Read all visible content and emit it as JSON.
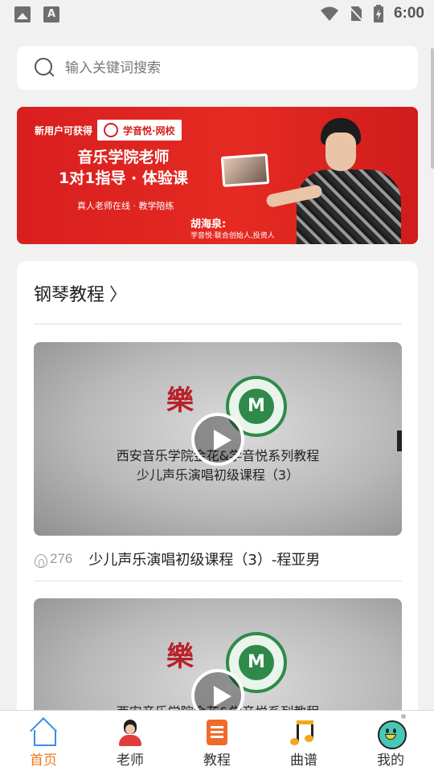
{
  "status_bar": {
    "time": "6:00",
    "icons": [
      "image-notification-icon",
      "font-notification-icon",
      "wifi-icon",
      "no-sim-icon",
      "battery-charging-icon"
    ]
  },
  "search": {
    "placeholder": "输入关键词搜索",
    "icon": "search-icon"
  },
  "banner": {
    "new_user_label": "新用户可获得",
    "brand": "学音悦·网校",
    "headline_line1": "音乐学院老师",
    "headline_line2": "1对1指导 · 体验课",
    "subline": "真人老师在线 · 教学陪练",
    "person_name": "胡海泉:",
    "person_title": "学音悦·联合创始人,投资人",
    "accent_color": "#d81f1f"
  },
  "section": {
    "title": "钢琴教程",
    "chevron": "〉"
  },
  "videos": [
    {
      "cover_caption_line1": "西安音乐学院金花&学音悦系列教程",
      "cover_caption_line2": "少儿声乐演唱初级课程（3）",
      "logo_left_glyph": "樂",
      "logo_right_text": "M",
      "views": "276",
      "title": "少儿声乐演唱初级课程（3）-程亚男"
    },
    {
      "cover_caption_line1": "西安音乐学院金花&学音悦系列教程",
      "logo_left_glyph": "樂",
      "logo_right_text": "M"
    }
  ],
  "tabbar": {
    "active_color": "#f07a1a",
    "items": [
      {
        "label": "首页",
        "icon": "home-icon",
        "active": true
      },
      {
        "label": "老师",
        "icon": "teacher-icon",
        "active": false
      },
      {
        "label": "教程",
        "icon": "course-icon",
        "active": false
      },
      {
        "label": "曲谱",
        "icon": "music-score-icon",
        "active": false
      },
      {
        "label": "我的",
        "icon": "profile-icon",
        "active": false
      }
    ]
  }
}
